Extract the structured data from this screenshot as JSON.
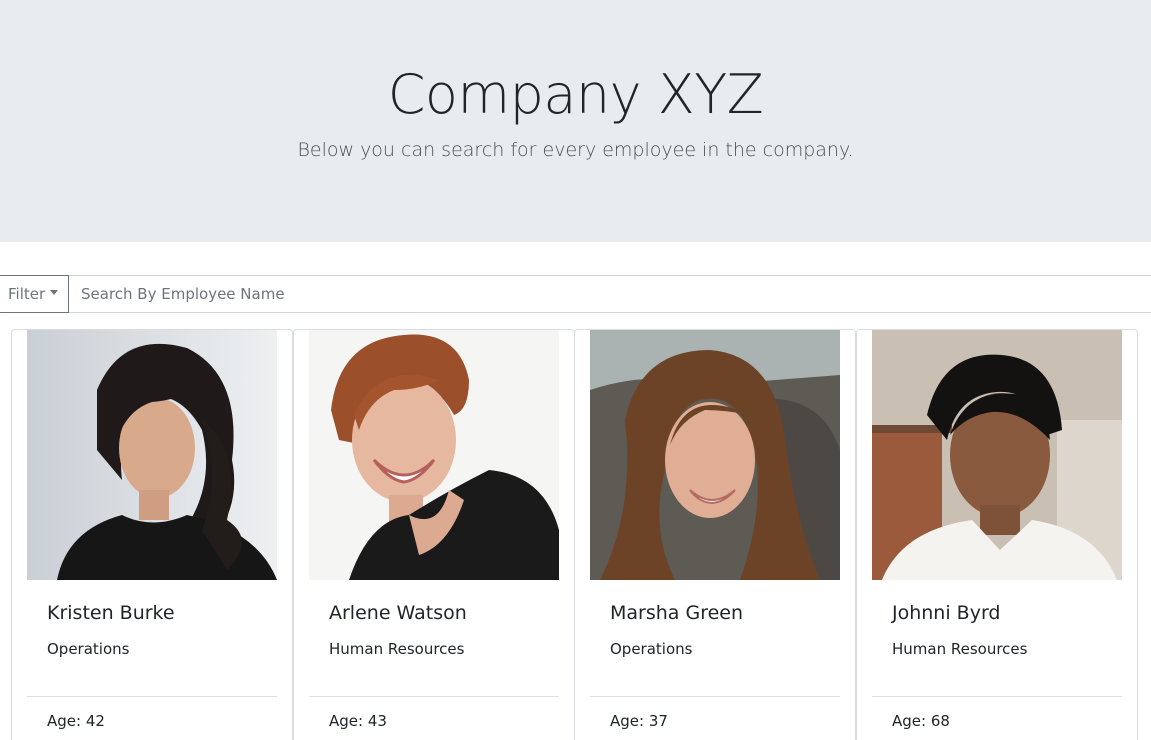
{
  "header": {
    "title": "Company XYZ",
    "subtitle": "Below you can search for every employee in the company."
  },
  "search": {
    "filter_label": "Filter",
    "placeholder": "Search By Employee Name",
    "value": ""
  },
  "employees": [
    {
      "name": "Kristen Burke",
      "department": "Operations",
      "age": "Age: 42",
      "photo": "portrait-photo"
    },
    {
      "name": "Arlene Watson",
      "department": "Human Resources",
      "age": "Age: 43",
      "photo": "portrait-photo"
    },
    {
      "name": "Marsha Green",
      "department": "Operations",
      "age": "Age: 37",
      "photo": "portrait-photo"
    },
    {
      "name": "Johnni Byrd",
      "department": "Human Resources",
      "age": "Age: 68",
      "photo": "portrait-photo"
    }
  ],
  "colors": {
    "header_bg": "#e9ecef",
    "border": "#ced4da",
    "filter_text": "#6c757d"
  }
}
